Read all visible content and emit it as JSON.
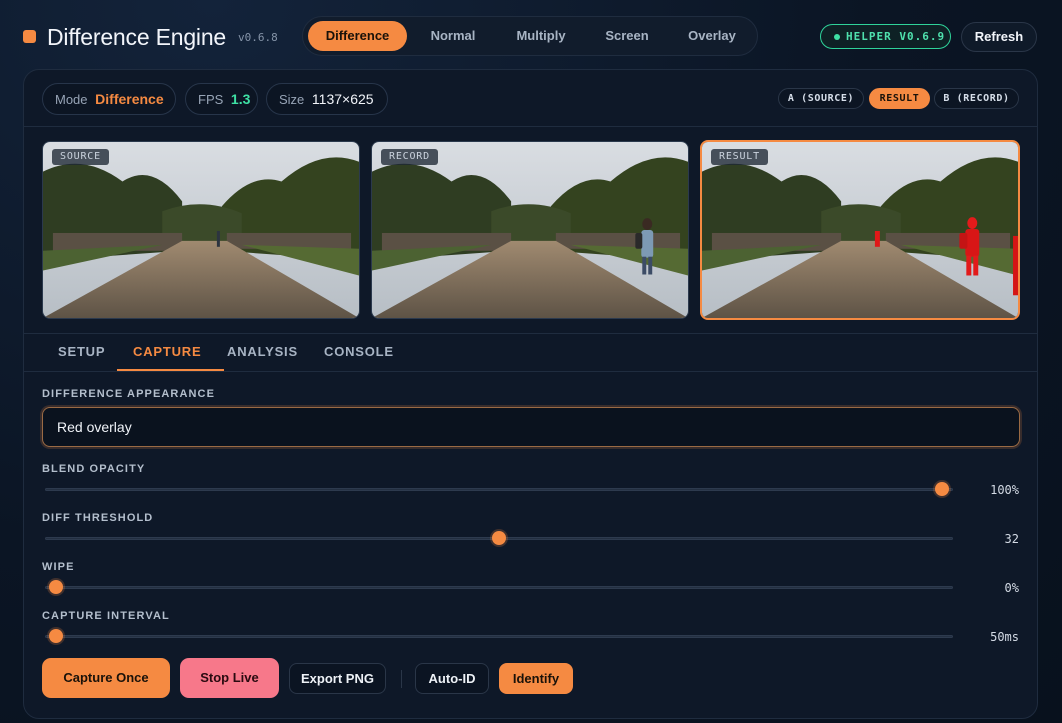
{
  "app": {
    "title": "Difference Engine",
    "version": "v0.6.8",
    "accent_color": "#f58a42"
  },
  "header": {
    "mode_tabs": [
      {
        "label": "Difference",
        "active": true
      },
      {
        "label": "Normal",
        "active": false
      },
      {
        "label": "Multiply",
        "active": false
      },
      {
        "label": "Screen",
        "active": false
      },
      {
        "label": "Overlay",
        "active": false
      }
    ],
    "helper_badge": "HELPER V0.6.9",
    "helper_color": "#3ee0a4",
    "refresh_label": "Refresh"
  },
  "stats": {
    "mode_key": "Mode",
    "mode_value": "Difference",
    "fps_key": "FPS",
    "fps_value": "1.3",
    "size_key": "Size",
    "size_value": "1137×625"
  },
  "view_toggles": [
    {
      "label": "A (SOURCE)",
      "active": false
    },
    {
      "label": "RESULT",
      "active": true
    },
    {
      "label": "B (RECORD)",
      "active": false
    }
  ],
  "previews": [
    {
      "label": "SOURCE"
    },
    {
      "label": "RECORD"
    },
    {
      "label": "RESULT"
    }
  ],
  "tabs": [
    {
      "label": "SETUP",
      "active": false
    },
    {
      "label": "CAPTURE",
      "active": true
    },
    {
      "label": "ANALYSIS",
      "active": false
    },
    {
      "label": "CONSOLE",
      "active": false
    }
  ],
  "controls": {
    "appearance_label": "DIFFERENCE APPEARANCE",
    "appearance_value": "Red overlay",
    "sliders": [
      {
        "label": "BLEND OPACITY",
        "display": "100%",
        "fraction": 1.0
      },
      {
        "label": "DIFF THRESHOLD",
        "display": "32",
        "fraction": 0.5
      },
      {
        "label": "WIPE",
        "display": "0%",
        "fraction": 0.0
      },
      {
        "label": "CAPTURE INTERVAL",
        "display": "50ms",
        "fraction": 0.0
      }
    ]
  },
  "actions": {
    "capture_once": "Capture Once",
    "stop_live": "Stop Live",
    "export_png": "Export PNG",
    "auto_id": "Auto-ID",
    "identify": "Identify"
  }
}
